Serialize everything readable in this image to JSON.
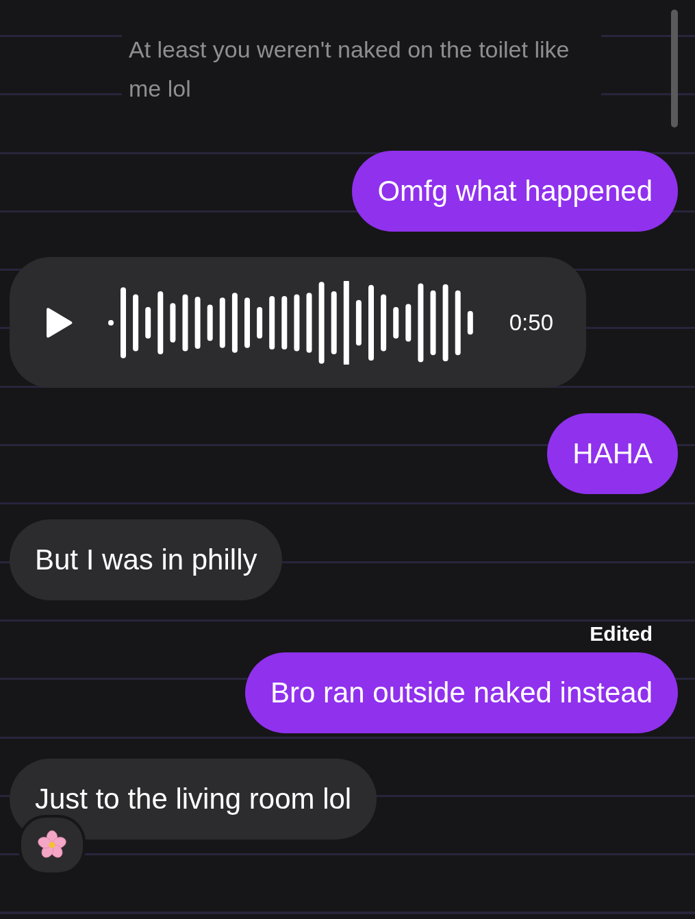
{
  "messages": [
    {
      "kind": "quoted",
      "text": "At least you weren't naked on the toilet like me lol"
    },
    {
      "kind": "sent",
      "text": "Omfg what happened"
    },
    {
      "kind": "voice",
      "duration": "0:50"
    },
    {
      "kind": "sent",
      "text": "HAHA"
    },
    {
      "kind": "received",
      "text": "But I was in philly"
    },
    {
      "kind": "sent",
      "text": "Bro ran outside naked instead",
      "label": "Edited"
    },
    {
      "kind": "received",
      "text": "Just to the living room lol",
      "reacted": true
    }
  ]
}
